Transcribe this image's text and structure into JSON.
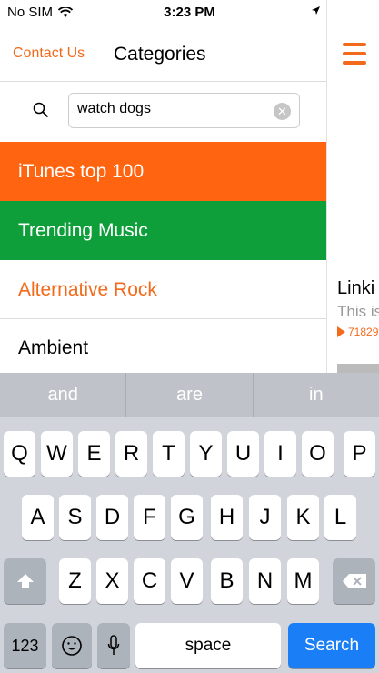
{
  "status": {
    "carrier": "No SIM",
    "time": "3:23 PM"
  },
  "nav": {
    "contact_label": "Contact Us",
    "title": "Categories"
  },
  "search": {
    "value": "watch dogs"
  },
  "categories": [
    {
      "label": "iTunes top 100"
    },
    {
      "label": "Trending Music"
    },
    {
      "label": "Alternative Rock"
    },
    {
      "label": "Ambient"
    }
  ],
  "peek": {
    "title": "Linki",
    "subtitle": "This is",
    "count": "71829"
  },
  "suggestions": [
    "and",
    "are",
    "in"
  ],
  "keyboard": {
    "row1": [
      "Q",
      "W",
      "E",
      "R",
      "T",
      "Y",
      "U",
      "I",
      "O",
      "P"
    ],
    "row2": [
      "A",
      "S",
      "D",
      "F",
      "G",
      "H",
      "J",
      "K",
      "L"
    ],
    "row3": [
      "Z",
      "X",
      "C",
      "V",
      "B",
      "N",
      "M"
    ],
    "num_label": "123",
    "space_label": "space",
    "search_label": "Search"
  },
  "colors": {
    "accent": "#f26a1b",
    "orange_row": "#ff6411",
    "green_row": "#0e9e3a",
    "key_blue": "#1a7ff6"
  }
}
